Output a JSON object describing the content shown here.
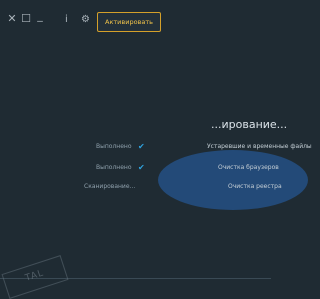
{
  "window": {
    "close_glyph": "✕",
    "restore_glyph": "☐",
    "minimize_glyph": "_",
    "info_glyph": "i",
    "settings_glyph": "⚙",
    "activate_label": "Активировать"
  },
  "scan": {
    "title": "...ирование...",
    "rows": [
      {
        "label": "Устаревшие и временные файлы",
        "status": "Выполнено",
        "check": "✔"
      },
      {
        "label": "Очистка браузеров",
        "status": "Выполнено",
        "check": "✔"
      },
      {
        "label": "Очистка реестра",
        "status": "Сканирование...",
        "check": ""
      }
    ]
  },
  "watermark": {
    "text": "TAL"
  },
  "colors": {
    "accent": "#d4a02a",
    "check": "#2fa3e0",
    "background": "#1f2b33"
  }
}
